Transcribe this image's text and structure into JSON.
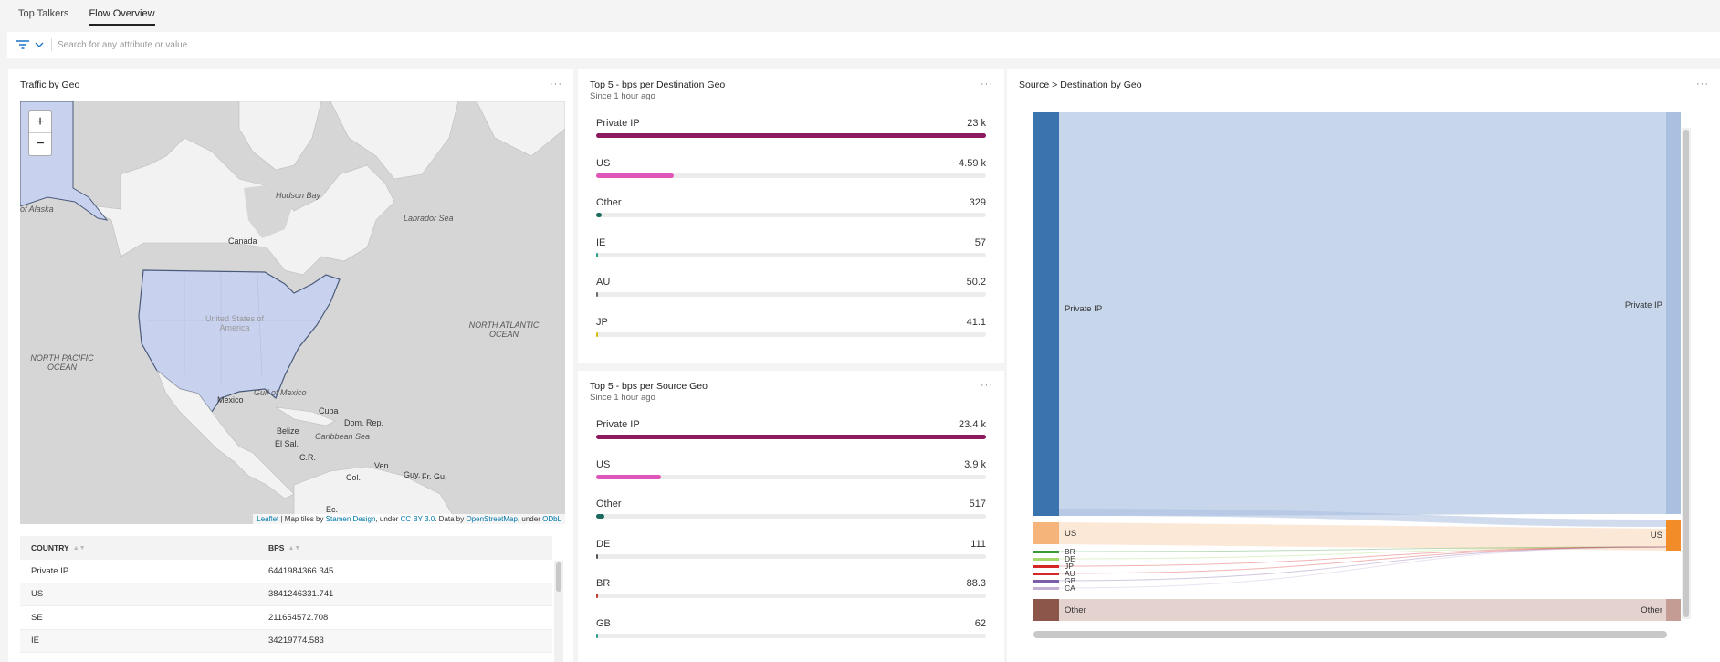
{
  "tabs": [
    {
      "label": "Top Talkers",
      "active": false
    },
    {
      "label": "Flow Overview",
      "active": true
    }
  ],
  "filter": {
    "placeholder": "Search for any attribute or value."
  },
  "geo_panel": {
    "title": "Traffic by Geo",
    "zoom_in": "+",
    "zoom_out": "−",
    "map_labels": {
      "alaska": "of Alaska",
      "hudson": "Hudson Bay",
      "labrador": "Labrador Sea",
      "canada": "Canada",
      "usa": "United States of America",
      "npac": "NORTH PACIFIC OCEAN",
      "natl": "NORTH ATLANTIC OCEAN",
      "mexico": "Mexico",
      "gulf": "Gulf of Mexico",
      "cuba": "Cuba",
      "domrep": "Dom. Rep.",
      "belize": "Belize",
      "elsal": "El Sal.",
      "caribbean": "Caribbean Sea",
      "cr": "C.R.",
      "ven": "Ven.",
      "col": "Col.",
      "guy": "Guy.",
      "frgu": "Fr. Gu.",
      "ec": "Ec."
    },
    "attribution": {
      "leaflet": "Leaflet",
      "t1": " | Map tiles by ",
      "stamen": "Stamen Design",
      "t2": ", under ",
      "ccby": "CC BY 3.0",
      "t3": ". Data by ",
      "osm": "OpenStreetMap",
      "t4": ", under ",
      "odbl": "ODbL"
    },
    "table": {
      "headers": [
        "COUNTRY",
        "BPS"
      ],
      "rows": [
        [
          "Private IP",
          "6441984366.345"
        ],
        [
          "US",
          "3841246331.741"
        ],
        [
          "SE",
          "211654572.708"
        ],
        [
          "IE",
          "34219774.583"
        ]
      ]
    }
  },
  "dest_panel": {
    "title": "Top 5 - bps per Destination Geo",
    "subtitle": "Since 1 hour ago",
    "items": [
      {
        "label": "Private IP",
        "value": "23 k",
        "fraction": 1.0,
        "color": "#8b1a5e"
      },
      {
        "label": "US",
        "value": "4.59 k",
        "fraction": 0.199,
        "color": "#e056b8"
      },
      {
        "label": "Other",
        "value": "329",
        "fraction": 0.014,
        "color": "#1a6b5e"
      },
      {
        "label": "IE",
        "value": "57",
        "fraction": 0.0025,
        "color": "#2a9d8f"
      },
      {
        "label": "AU",
        "value": "50.2",
        "fraction": 0.0022,
        "color": "#6b6b6b"
      },
      {
        "label": "JP",
        "value": "41.1",
        "fraction": 0.0018,
        "color": "#d4c000"
      }
    ]
  },
  "src_panel": {
    "title": "Top 5 - bps per Source Geo",
    "subtitle": "Since 1 hour ago",
    "items": [
      {
        "label": "Private IP",
        "value": "23.4 k",
        "fraction": 1.0,
        "color": "#8b1a5e"
      },
      {
        "label": "US",
        "value": "3.9 k",
        "fraction": 0.167,
        "color": "#e056b8"
      },
      {
        "label": "Other",
        "value": "517",
        "fraction": 0.022,
        "color": "#1a6b5e"
      },
      {
        "label": "DE",
        "value": "111",
        "fraction": 0.0047,
        "color": "#555555"
      },
      {
        "label": "BR",
        "value": "88.3",
        "fraction": 0.0038,
        "color": "#c0392b"
      },
      {
        "label": "GB",
        "value": "62",
        "fraction": 0.0026,
        "color": "#2a9d8f"
      }
    ]
  },
  "sankey_panel": {
    "title": "Source > Destination by Geo",
    "left_nodes": [
      {
        "label": "Private IP",
        "color": "#3a73ad",
        "value": 23400
      },
      {
        "label": "US",
        "color": "#f5b47a",
        "value": 3900
      },
      {
        "label": "BR",
        "color": "#3a9a3a",
        "value": 88
      },
      {
        "label": "DE",
        "color": "#a6d96a",
        "value": 111
      },
      {
        "label": "JP",
        "color": "#d62728",
        "value": 41
      },
      {
        "label": "AU",
        "color": "#d62728",
        "value": 50
      },
      {
        "label": "GB",
        "color": "#7b5ea7",
        "value": 62
      },
      {
        "label": "CA",
        "color": "#c5b0d5",
        "value": 40
      },
      {
        "label": "Other",
        "color": "#8c564b",
        "value": 517
      }
    ],
    "right_nodes": [
      {
        "label": "Private IP",
        "color": "#a9c0e0"
      },
      {
        "label": "US",
        "color": "#f28c28"
      },
      {
        "label": "Other",
        "color": "#c49c94"
      }
    ]
  },
  "colors": {
    "accent": "#8b1a5e",
    "secondary": "#e056b8",
    "link_blue": "#0078a8"
  }
}
